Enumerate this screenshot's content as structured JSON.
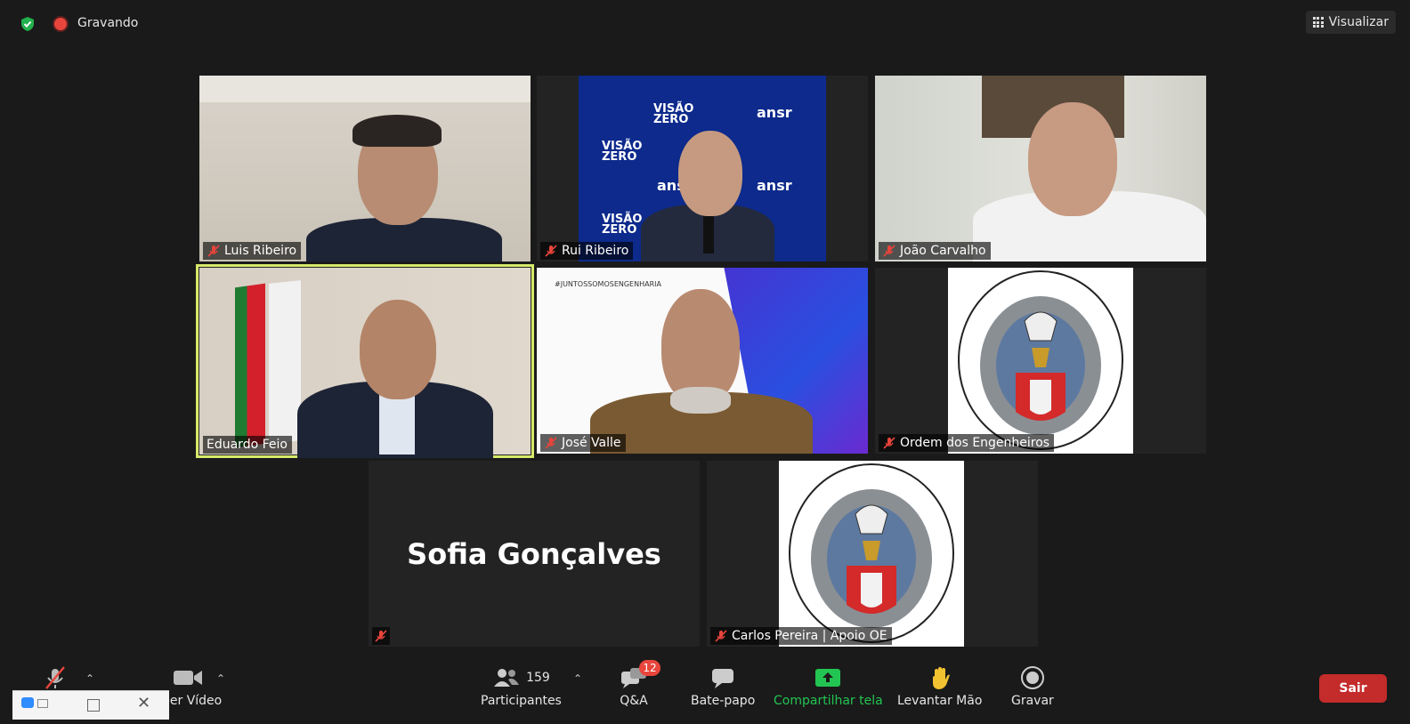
{
  "top_bar": {
    "recording_label": "Gravando",
    "view_label": "Visualizar"
  },
  "participants": [
    {
      "name": "Luis Ribeiro",
      "muted": true
    },
    {
      "name": "Rui Ribeiro",
      "muted": true
    },
    {
      "name": "João Carvalho",
      "muted": true
    },
    {
      "name": "Eduardo Feio",
      "muted": false,
      "active_speaker": true
    },
    {
      "name": "José Valle",
      "muted": true
    },
    {
      "name": "Ordem dos Engenheiros",
      "muted": true
    },
    {
      "name": "Sofia Gonçalves",
      "muted": true,
      "video_off": true
    },
    {
      "name": "Carlos Pereira | Apoio OE",
      "muted": true
    }
  ],
  "backdrop": {
    "visao": "VISÃO",
    "zero": "ZERO",
    "ansr": "ansr",
    "hashtag": "#JUNTOSSOMOSENGENHARIA"
  },
  "logo_text": "ORDEM DOS ENGENHEIROS",
  "toolbar": {
    "video_label": "ber Vídeo",
    "participants_count": "159",
    "participants_label": "Participantes",
    "qa_badge": "12",
    "qa_label": "Q&A",
    "chat_label": "Bate-papo",
    "share_label": "Compartilhar tela",
    "raise_hand_label": "Levantar Mão",
    "record_label": "Gravar",
    "leave_label": "Sair"
  },
  "colors": {
    "active_border": "#d6e96a",
    "share_green": "#23c552",
    "leave_red": "#c42b2b",
    "badge_red": "#e8453c"
  }
}
